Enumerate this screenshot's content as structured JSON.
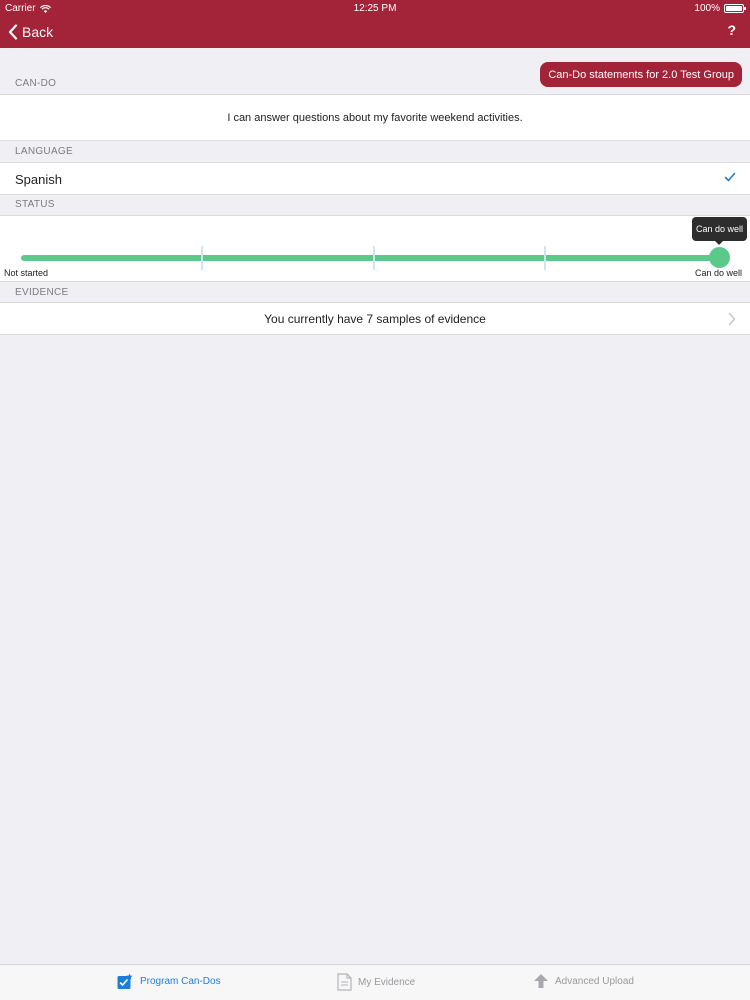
{
  "status_bar": {
    "carrier": "Carrier",
    "time": "12:25 PM",
    "battery_text": "100%",
    "battery_level": 1.0
  },
  "nav": {
    "back_label": "Back",
    "help_label": "?",
    "back_icon": "chevron-left-icon"
  },
  "can_do": {
    "section_label": "CAN-DO",
    "group_button_label": "Can-Do statements for 2.0 Test Group",
    "statement": "I can answer questions about my favorite weekend activities."
  },
  "language": {
    "section_label": "LANGUAGE",
    "value": "Spanish",
    "selected_icon": "checkmark-icon"
  },
  "status": {
    "section_label": "STATUS",
    "min_label": "Not started",
    "max_label": "Can do well",
    "tooltip": "Can do well",
    "steps": 5,
    "value_fraction": 1.0
  },
  "evidence": {
    "section_label": "EVIDENCE",
    "summary": "You currently have 7 samples of evidence"
  },
  "tabs": [
    {
      "label": "Program Can-Dos",
      "icon": "program-cando-icon",
      "active": true
    },
    {
      "label": "My Evidence",
      "icon": "evidence-document-icon",
      "active": false
    },
    {
      "label": "Advanced Upload",
      "icon": "upload-arrow-icon",
      "active": false
    }
  ],
  "colors": {
    "brand": "#a32338",
    "slider": "#5bc98a",
    "active_tab": "#1d7ed8",
    "check": "#1d7ed8"
  }
}
